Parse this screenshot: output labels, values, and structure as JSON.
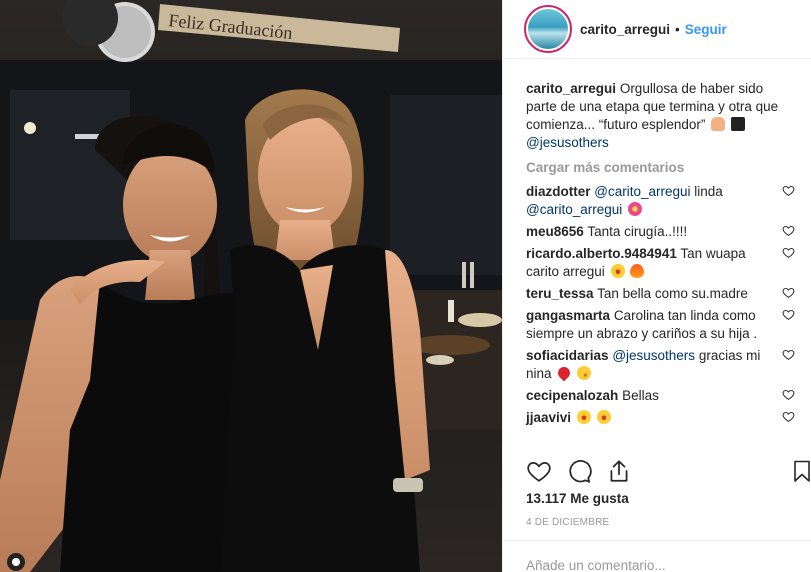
{
  "post": {
    "username": "carito_arregui",
    "separator": "•",
    "follow_label": "Seguir",
    "caption": {
      "username": "carito_arregui",
      "text": "Orgullosa de haber sido parte de una etapa que termina y otra que comienza... “futuro esplendor”",
      "emoji_icons": [
        "pray-hands-icon",
        "graduation-cap-icon"
      ],
      "mention": "@jesusothers"
    },
    "load_more_label": "Cargar más comentarios",
    "comments": [
      {
        "user": "diazdotter",
        "mention": "@carito_arregui",
        "text": "linda",
        "mention2": "@carito_arregui",
        "emoji": "hibiscus-icon"
      },
      {
        "user": "meu8656",
        "text": "Tanta cirugía..!!!!"
      },
      {
        "user": "ricardo.alberto.9484941",
        "text": "Tan wuapa carito arregui",
        "emojis": [
          "star-struck-icon",
          "fire-icon"
        ]
      },
      {
        "user": "teru_tessa",
        "text": "Tan bella como su.madre"
      },
      {
        "user": "gangasmarta",
        "text": "Carolina tan linda como siempre un abrazo y cariños a su hija ."
      },
      {
        "user": "sofiacidarias",
        "mention": "@jesusothers",
        "text": "gracias mi nina",
        "emojis": [
          "red-heart-icon",
          "winking-face-icon"
        ]
      },
      {
        "user": "cecipenalozah",
        "text": "Bellas"
      },
      {
        "user": "jjaavivi",
        "emojis": [
          "star-struck-icon",
          "star-struck-icon"
        ]
      }
    ],
    "likes": "13.117 Me gusta",
    "date": "4 DE DICIEMBRE",
    "add_comment_placeholder": "Añade un comentario...",
    "photo_banner": "Feliz Graduación"
  },
  "colors": {
    "link_blue": "#3897f0",
    "mention_blue": "#003569",
    "muted": "#999999",
    "text": "#262626"
  }
}
